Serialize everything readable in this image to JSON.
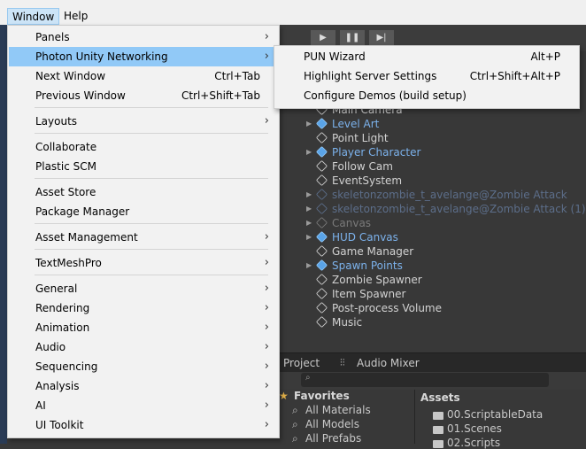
{
  "menubar": {
    "window": "Window",
    "help": "Help"
  },
  "window_menu": [
    {
      "label": "Panels",
      "shortcut": "",
      "submenu": true
    },
    {
      "label": "Photon Unity Networking",
      "shortcut": "",
      "submenu": true,
      "highlighted": true
    },
    {
      "label": "Next Window",
      "shortcut": "Ctrl+Tab",
      "submenu": false
    },
    {
      "label": "Previous Window",
      "shortcut": "Ctrl+Shift+Tab",
      "submenu": false
    },
    {
      "label": "Layouts",
      "shortcut": "",
      "submenu": true
    },
    {
      "label": "Collaborate",
      "shortcut": "",
      "submenu": false
    },
    {
      "label": "Plastic SCM",
      "shortcut": "",
      "submenu": false
    },
    {
      "label": "Asset Store",
      "shortcut": "",
      "submenu": false
    },
    {
      "label": "Package Manager",
      "shortcut": "",
      "submenu": false
    },
    {
      "label": "Asset Management",
      "shortcut": "",
      "submenu": true
    },
    {
      "label": "TextMeshPro",
      "shortcut": "",
      "submenu": true
    },
    {
      "label": "General",
      "shortcut": "",
      "submenu": true
    },
    {
      "label": "Rendering",
      "shortcut": "",
      "submenu": true
    },
    {
      "label": "Animation",
      "shortcut": "",
      "submenu": true
    },
    {
      "label": "Audio",
      "shortcut": "",
      "submenu": true
    },
    {
      "label": "Sequencing",
      "shortcut": "",
      "submenu": true
    },
    {
      "label": "Analysis",
      "shortcut": "",
      "submenu": true
    },
    {
      "label": "AI",
      "shortcut": "",
      "submenu": true
    },
    {
      "label": "UI Toolkit",
      "shortcut": "",
      "submenu": true
    }
  ],
  "pun_submenu": [
    {
      "label": "PUN Wizard",
      "shortcut": "Alt+P"
    },
    {
      "label": "Highlight Server Settings",
      "shortcut": "Ctrl+Shift+Alt+P"
    },
    {
      "label": "Configure Demos (build setup)",
      "shortcut": ""
    }
  ],
  "toolbar": {
    "play_icon": "play-icon",
    "pause_icon": "pause-icon",
    "step_icon": "step-icon"
  },
  "hierarchy": [
    {
      "label": "Main Camera",
      "kind": "plain",
      "expandable": false
    },
    {
      "label": "Level Art",
      "kind": "prefab",
      "expandable": true
    },
    {
      "label": "Point Light",
      "kind": "plain",
      "expandable": false
    },
    {
      "label": "Player Character",
      "kind": "prefab",
      "expandable": true
    },
    {
      "label": "Follow Cam",
      "kind": "plain",
      "expandable": false
    },
    {
      "label": "EventSystem",
      "kind": "plain",
      "expandable": false
    },
    {
      "label": "skeletonzombie_t_avelange@Zombie Attack",
      "kind": "missing",
      "expandable": true
    },
    {
      "label": "skeletonzombie_t_avelange@Zombie Attack (1)",
      "kind": "missing",
      "expandable": true
    },
    {
      "label": "Canvas",
      "kind": "disabled",
      "expandable": true
    },
    {
      "label": "HUD Canvas",
      "kind": "prefab",
      "expandable": true
    },
    {
      "label": "Game Manager",
      "kind": "plain",
      "expandable": false
    },
    {
      "label": "Spawn Points",
      "kind": "prefab",
      "expandable": true
    },
    {
      "label": "Zombie Spawner",
      "kind": "plain",
      "expandable": false
    },
    {
      "label": "Item Spawner",
      "kind": "plain",
      "expandable": false
    },
    {
      "label": "Post-process Volume",
      "kind": "plain",
      "expandable": false
    },
    {
      "label": "Music",
      "kind": "plain",
      "expandable": false
    }
  ],
  "project": {
    "tab_project": "Project",
    "tab_audio_mixer": "Audio Mixer",
    "favorites_label": "Favorites",
    "favorites": [
      "All Materials",
      "All Models",
      "All Prefabs"
    ],
    "assets_label": "Assets",
    "assets": [
      "00.ScriptableData",
      "01.Scenes",
      "02.Scripts"
    ]
  }
}
